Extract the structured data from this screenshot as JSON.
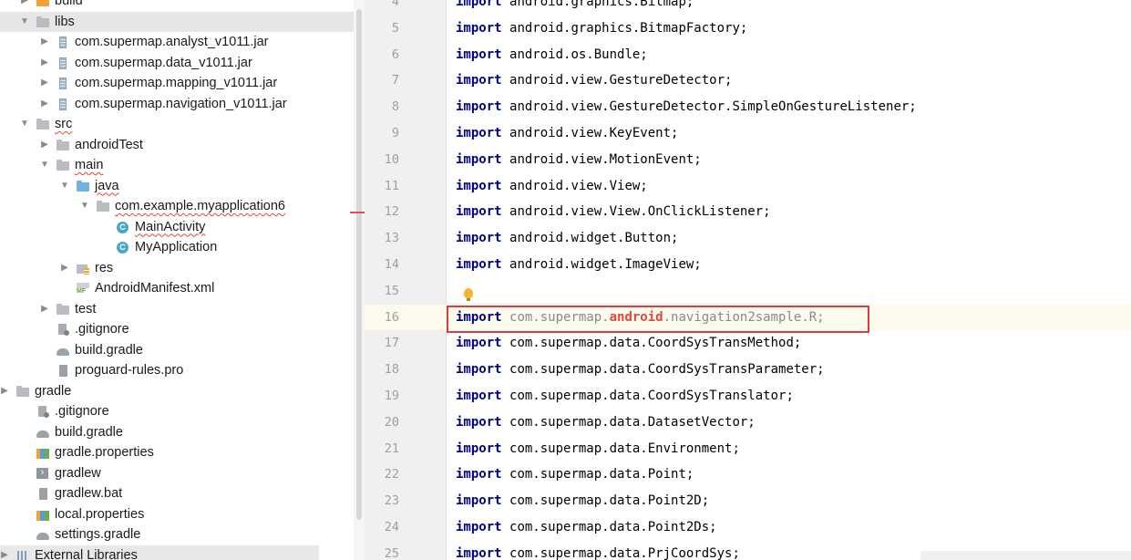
{
  "project_tree": {
    "items": [
      {
        "label": "build",
        "depth": 1,
        "arrow": "▶",
        "icon": "folder-orange-icon"
      },
      {
        "label": "libs",
        "depth": 1,
        "arrow": "▼",
        "icon": "folder-icon",
        "selected": true
      },
      {
        "label": "com.supermap.analyst_v1011.jar",
        "depth": 2,
        "arrow": "▶",
        "icon": "jar-icon"
      },
      {
        "label": "com.supermap.data_v1011.jar",
        "depth": 2,
        "arrow": "▶",
        "icon": "jar-icon"
      },
      {
        "label": "com.supermap.mapping_v1011.jar",
        "depth": 2,
        "arrow": "▶",
        "icon": "jar-icon"
      },
      {
        "label": "com.supermap.navigation_v1011.jar",
        "depth": 2,
        "arrow": "▶",
        "icon": "jar-icon"
      },
      {
        "label": "src",
        "depth": 1,
        "arrow": "▼",
        "icon": "folder-icon",
        "squiggle": true
      },
      {
        "label": "androidTest",
        "depth": 2,
        "arrow": "▶",
        "icon": "folder-icon"
      },
      {
        "label": "main",
        "depth": 2,
        "arrow": "▼",
        "icon": "folder-icon",
        "squiggle": true
      },
      {
        "label": "java",
        "depth": 3,
        "arrow": "▼",
        "icon": "folder-blue-icon",
        "squiggle": true
      },
      {
        "label": "com.example.myapplication6",
        "depth": 4,
        "arrow": "▼",
        "icon": "package-icon",
        "squiggle": true
      },
      {
        "label": "MainActivity",
        "depth": 5,
        "arrow": "",
        "icon": "class-icon",
        "squiggle": true
      },
      {
        "label": "MyApplication",
        "depth": 5,
        "arrow": "",
        "icon": "class-icon"
      },
      {
        "label": "res",
        "depth": 3,
        "arrow": "▶",
        "icon": "res-folder-icon"
      },
      {
        "label": "AndroidManifest.xml",
        "depth": 3,
        "arrow": "",
        "icon": "manifest-icon"
      },
      {
        "label": "test",
        "depth": 2,
        "arrow": "▶",
        "icon": "folder-icon"
      },
      {
        "label": ".gitignore",
        "depth": 2,
        "arrow": "",
        "icon": "gitignore-icon"
      },
      {
        "label": "build.gradle",
        "depth": 2,
        "arrow": "",
        "icon": "gradle-icon"
      },
      {
        "label": "proguard-rules.pro",
        "depth": 2,
        "arrow": "",
        "icon": "text-file-icon"
      },
      {
        "label": "gradle",
        "depth": 0,
        "arrow": "▶",
        "icon": "folder-icon"
      },
      {
        "label": ".gitignore",
        "depth": 1,
        "arrow": "",
        "icon": "gitignore-icon"
      },
      {
        "label": "build.gradle",
        "depth": 1,
        "arrow": "",
        "icon": "gradle-icon"
      },
      {
        "label": "gradle.properties",
        "depth": 1,
        "arrow": "",
        "icon": "properties-icon"
      },
      {
        "label": "gradlew",
        "depth": 1,
        "arrow": "",
        "icon": "terminal-file-icon"
      },
      {
        "label": "gradlew.bat",
        "depth": 1,
        "arrow": "",
        "icon": "text-file-icon"
      },
      {
        "label": "local.properties",
        "depth": 1,
        "arrow": "",
        "icon": "properties-icon"
      },
      {
        "label": "settings.gradle",
        "depth": 1,
        "arrow": "",
        "icon": "gradle-icon"
      },
      {
        "label": "External Libraries",
        "depth": 0,
        "arrow": "▶",
        "icon": "libraries-icon",
        "partial": true
      }
    ]
  },
  "editor": {
    "lines": [
      {
        "no": "4",
        "keyword": "import",
        "path": "android.graphics.Bitmap;"
      },
      {
        "no": "5",
        "keyword": "import",
        "path": "android.graphics.BitmapFactory;"
      },
      {
        "no": "6",
        "keyword": "import",
        "path": "android.os.Bundle;"
      },
      {
        "no": "7",
        "keyword": "import",
        "path": "android.view.GestureDetector;"
      },
      {
        "no": "8",
        "keyword": "import",
        "path": "android.view.GestureDetector.SimpleOnGestureListener;"
      },
      {
        "no": "9",
        "keyword": "import",
        "path": "android.view.KeyEvent;"
      },
      {
        "no": "10",
        "keyword": "import",
        "path": "android.view.MotionEvent;"
      },
      {
        "no": "11",
        "keyword": "import",
        "path": "android.view.View;"
      },
      {
        "no": "12",
        "keyword": "import",
        "path": "android.view.View.OnClickListener;"
      },
      {
        "no": "13",
        "keyword": "import",
        "path": "android.widget.Button;"
      },
      {
        "no": "14",
        "keyword": "import",
        "path": "android.widget.ImageView;"
      },
      {
        "no": "15",
        "keyword": "",
        "path": ""
      },
      {
        "no": "16",
        "keyword": "import",
        "segments": [
          {
            "text": "com.supermap.",
            "cls": "dim"
          },
          {
            "text": "android",
            "cls": "err"
          },
          {
            "text": ".navigation2sample.R;",
            "cls": "dim"
          }
        ],
        "current": true
      },
      {
        "no": "17",
        "keyword": "import",
        "path": "com.supermap.data.CoordSysTransMethod;"
      },
      {
        "no": "18",
        "keyword": "import",
        "path": "com.supermap.data.CoordSysTransParameter;"
      },
      {
        "no": "19",
        "keyword": "import",
        "path": "com.supermap.data.CoordSysTranslator;"
      },
      {
        "no": "20",
        "keyword": "import",
        "path": "com.supermap.data.DatasetVector;"
      },
      {
        "no": "21",
        "keyword": "import",
        "path": "com.supermap.data.Environment;"
      },
      {
        "no": "22",
        "keyword": "import",
        "path": "com.supermap.data.Point;"
      },
      {
        "no": "23",
        "keyword": "import",
        "path": "com.supermap.data.Point2D;"
      },
      {
        "no": "24",
        "keyword": "import",
        "path": "com.supermap.data.Point2Ds;"
      },
      {
        "no": "25",
        "keyword": "import",
        "path": "com.supermap.data.PrjCoordSys;"
      }
    ]
  }
}
